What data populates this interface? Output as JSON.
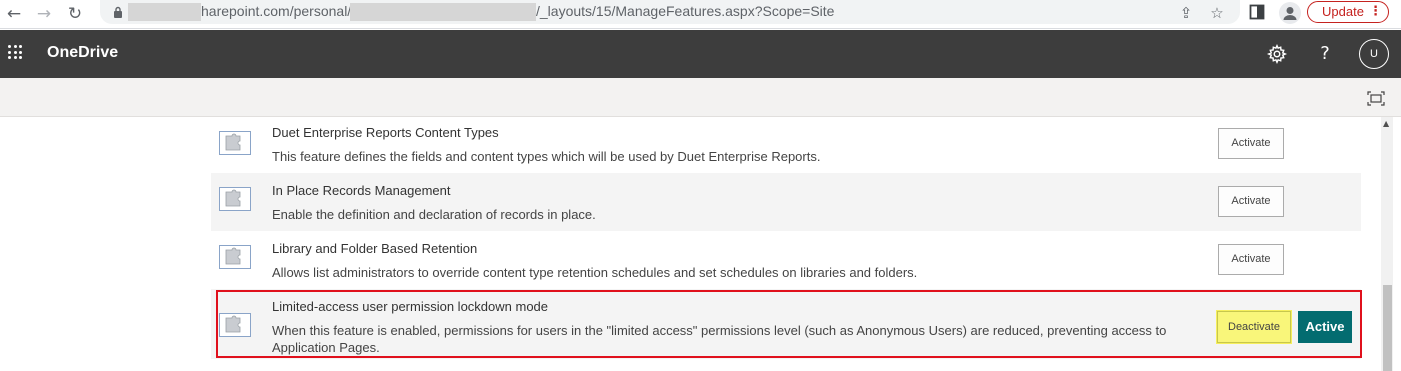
{
  "browser": {
    "back_icon": "arrow-left-icon",
    "forward_icon": "arrow-right-icon",
    "reload_icon": "reload-icon",
    "url_host": "harepoint.com/personal/",
    "url_path": "/_layouts/15/ManageFeatures.aspx?Scope=Site",
    "share_icon": "share-icon",
    "bookmark_icon": "star-icon",
    "sidepanel_icon": "side-panel-icon",
    "update_label": "Update"
  },
  "suite_header": {
    "app_name": "OneDrive",
    "settings_icon": "gear-icon",
    "help_label": "?",
    "avatar_initial": "U"
  },
  "features": [
    {
      "title": "Duet Enterprise Reports Content Types",
      "description": "This feature defines the fields and content types which will be used by Duet Enterprise Reports.",
      "action_label": "Activate"
    },
    {
      "title": "In Place Records Management",
      "description": "Enable the definition and declaration of records in place.",
      "action_label": "Activate"
    },
    {
      "title": "Library and Folder Based Retention",
      "description": "Allows list administrators to override content type retention schedules and set schedules on libraries and folders.",
      "action_label": "Activate"
    },
    {
      "title": "Limited-access user permission lockdown mode",
      "description": "When this feature is enabled, permissions for users in the \"limited access\" permissions level (such as Anonymous Users) are reduced, preventing access to Application Pages.",
      "action_label": "Deactivate",
      "status": "Active"
    }
  ],
  "colors": {
    "suite_bar": "#3d3d3d",
    "active_badge": "#036c70",
    "highlight_border": "#e0101c",
    "deactivate_highlight": "#f9f67a"
  }
}
